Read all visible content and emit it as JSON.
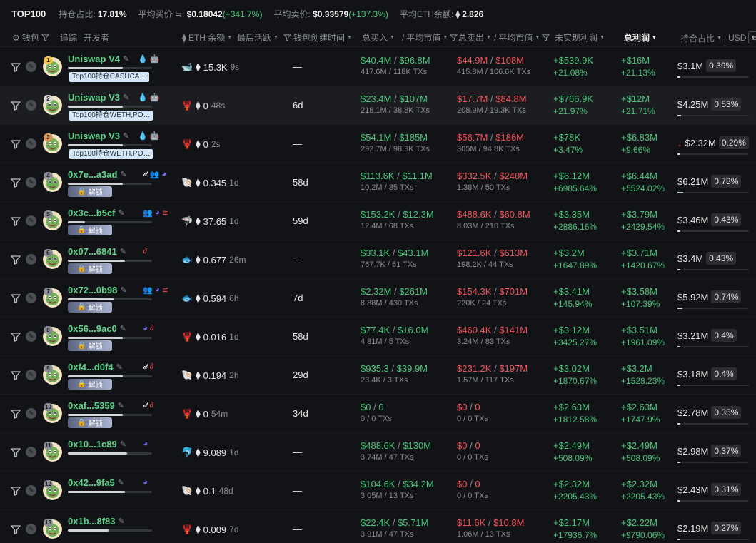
{
  "summary": {
    "title": "TOP100",
    "hold_label": "持仓占比:",
    "hold_value": "17.81%",
    "avg_buy_label": "平均买价 ≒:",
    "avg_buy_value": "$0.18042",
    "avg_buy_change": "(+341.7%)",
    "avg_sell_label": "平均卖价:",
    "avg_sell_value": "$0.33579",
    "avg_sell_change": "(+137.3%)",
    "eth_balance_label": "平均ETH余额:",
    "eth_balance_value": "2.826"
  },
  "header": {
    "wallet": "钱包",
    "track": "追踪",
    "developer": "开发者",
    "eth_balance": "ETH 余额",
    "last_active": "最后活跃",
    "wallet_created": "钱包创建时间",
    "total_buy": "总买入",
    "avg_mcap_buy": "平均市值",
    "total_sell": "总卖出",
    "avg_mcap_sell": "平均市值",
    "unrealized": "未实现利润",
    "total_profit": "总利润",
    "holding": "持合占比",
    "currency": "USD"
  },
  "colors": {
    "green": "#48c57a",
    "red": "#f0525b",
    "name": "#5fd38b"
  },
  "rows": [
    {
      "rank": "1",
      "name": "Uniswap V4",
      "tag": "Top100持仓CASHCA…",
      "locked": false,
      "icons": [
        "drops-icon",
        "robot-icon"
      ],
      "progress": 0.65,
      "animal": "whale-icon",
      "animal_glyph": "🐋",
      "eth": "15.3K",
      "ago": "9s",
      "created": "—",
      "buy": "$40.4M",
      "buy_mcap": "$96.8M",
      "buy_sub": "417.6M / 118K TXs",
      "sell": "$44.9M",
      "sell_mcap": "$108M",
      "sell_sub": "415.8M / 106.6K TXs",
      "unreal": "+$539.9K",
      "unreal_pct": "+21.08%",
      "total": "+$16M",
      "total_pct": "+21.13%",
      "hold": "$3.1M",
      "hold_pct": "0.39%",
      "hold_fill": 0.39,
      "down": false,
      "badge": "#f0c84a"
    },
    {
      "rank": "2",
      "name": "Uniswap V3",
      "tag": "Top100持仓WETH,PO…",
      "locked": false,
      "icons": [
        "drops-icon",
        "robot-icon"
      ],
      "progress": 0.65,
      "animal": "shrimp-icon",
      "animal_glyph": "🦞",
      "eth": "0",
      "ago": "48s",
      "created": "6d",
      "buy": "$23.4M",
      "buy_mcap": "$107M",
      "buy_sub": "218.1M / 38.8K TXs",
      "sell": "$17.7M",
      "sell_mcap": "$84.8M",
      "sell_sub": "208.9M / 19.3K TXs",
      "unreal": "+$766.9K",
      "unreal_pct": "+21.97%",
      "total": "+$12M",
      "total_pct": "+21.71%",
      "hold": "$4.25M",
      "hold_pct": "0.53%",
      "hold_fill": 0.53,
      "down": false,
      "badge": "#d8d8d8"
    },
    {
      "rank": "3",
      "name": "Uniswap V3",
      "tag": "Top100持仓WETH,PO…",
      "locked": false,
      "icons": [
        "drops-icon",
        "robot-icon"
      ],
      "progress": 0.65,
      "animal": "shrimp-icon",
      "animal_glyph": "🦞",
      "eth": "0",
      "ago": "2s",
      "created": "—",
      "buy": "$54.1M",
      "buy_mcap": "$185M",
      "buy_sub": "292.7M / 98.3K TXs",
      "sell": "$56.7M",
      "sell_mcap": "$186M",
      "sell_sub": "305M / 94.8K TXs",
      "unreal": "+$78K",
      "unreal_pct": "+3.47%",
      "total": "+$6.83M",
      "total_pct": "+9.66%",
      "hold": "$2.32M",
      "hold_pct": "0.29%",
      "hold_fill": 0.29,
      "down": true,
      "badge": "#d9985a"
    },
    {
      "rank": "4",
      "name": "0x7e...a3ad",
      "locked": true,
      "unlock_label": "解锁",
      "icons": [
        "tool-icon",
        "people-icon",
        "moon-icon"
      ],
      "progress": 0.65,
      "animal": "shell-icon",
      "animal_glyph": "🐚",
      "eth": "0.345",
      "ago": "1d",
      "created": "58d",
      "buy": "$113.6K",
      "buy_mcap": "$11.1M",
      "buy_sub": "10.2M / 35 TXs",
      "sell": "$332.5K",
      "sell_mcap": "$240M",
      "sell_sub": "1.38M / 50 TXs",
      "unreal": "+$6.12M",
      "unreal_pct": "+6985.64%",
      "total": "+$6.44M",
      "total_pct": "+5524.02%",
      "hold": "$6.21M",
      "hold_pct": "0.78%",
      "hold_fill": 0.78,
      "down": false,
      "badge": "#8a8d93"
    },
    {
      "rank": "5",
      "name": "0x3c...b5cf",
      "locked": true,
      "unlock_label": "解锁",
      "icons": [
        "people-icon",
        "moon-icon",
        "layers-icon"
      ],
      "progress": 0.2,
      "animal": "shark-icon",
      "animal_glyph": "🦈",
      "eth": "37.65",
      "ago": "1d",
      "created": "59d",
      "buy": "$153.2K",
      "buy_mcap": "$12.3M",
      "buy_sub": "12.4M / 68 TXs",
      "sell": "$488.6K",
      "sell_mcap": "$60.8M",
      "sell_sub": "8.03M / 210 TXs",
      "unreal": "+$3.35M",
      "unreal_pct": "+2886.16%",
      "total": "+$3.79M",
      "total_pct": "+2429.54%",
      "hold": "$3.46M",
      "hold_pct": "0.43%",
      "hold_fill": 0.43,
      "down": false,
      "badge": "#8a8d93"
    },
    {
      "rank": "6",
      "name": "0x07...6841",
      "locked": true,
      "unlock_label": "解锁",
      "icons": [
        "link-icon"
      ],
      "progress": 0.68,
      "animal": "fish-icon",
      "animal_glyph": "🐟",
      "eth": "0.677",
      "ago": "26m",
      "created": "—",
      "buy": "$33.1K",
      "buy_mcap": "$43.1M",
      "buy_sub": "767.7K / 51 TXs",
      "sell": "$121.6K",
      "sell_mcap": "$613M",
      "sell_sub": "198.2K / 44 TXs",
      "unreal": "+$3.2M",
      "unreal_pct": "+1647.89%",
      "total": "+$3.71M",
      "total_pct": "+1420.67%",
      "hold": "$3.4M",
      "hold_pct": "0.43%",
      "hold_fill": 0.43,
      "down": false,
      "badge": "#8a8d93"
    },
    {
      "rank": "7",
      "name": "0x72...0b98",
      "locked": true,
      "unlock_label": "解锁",
      "icons": [
        "people-icon",
        "moon-icon",
        "layers-icon"
      ],
      "progress": 0.55,
      "animal": "fish-icon",
      "animal_glyph": "🐟",
      "eth": "0.594",
      "ago": "6h",
      "created": "7d",
      "buy": "$2.32M",
      "buy_mcap": "$261M",
      "buy_sub": "8.88M / 430 TXs",
      "sell": "$154.3K",
      "sell_mcap": "$701M",
      "sell_sub": "220K / 24 TXs",
      "unreal": "+$3.41M",
      "unreal_pct": "+145.94%",
      "total": "+$3.58M",
      "total_pct": "+107.39%",
      "hold": "$5.92M",
      "hold_pct": "0.74%",
      "hold_fill": 0.74,
      "down": false,
      "badge": "#8a8d93"
    },
    {
      "rank": "8",
      "name": "0x56...9ac0",
      "locked": true,
      "unlock_label": "解锁",
      "icons": [
        "moon-icon",
        "link-icon"
      ],
      "progress": 0.65,
      "animal": "shrimp-icon",
      "animal_glyph": "🦞",
      "eth": "0.016",
      "ago": "1d",
      "created": "58d",
      "buy": "$77.4K",
      "buy_mcap": "$16.0M",
      "buy_sub": "4.81M / 5 TXs",
      "sell": "$460.4K",
      "sell_mcap": "$141M",
      "sell_sub": "3.24M / 83 TXs",
      "unreal": "+$3.12M",
      "unreal_pct": "+3425.27%",
      "total": "+$3.51M",
      "total_pct": "+1961.09%",
      "hold": "$3.21M",
      "hold_pct": "0.4%",
      "hold_fill": 0.4,
      "down": false,
      "badge": "#8a8d93"
    },
    {
      "rank": "9",
      "name": "0xf4...d0f4",
      "locked": true,
      "unlock_label": "解锁",
      "icons": [
        "tool-icon",
        "link-icon"
      ],
      "progress": 0.65,
      "animal": "shell-icon",
      "animal_glyph": "🐚",
      "eth": "0.194",
      "ago": "2h",
      "created": "29d",
      "buy": "$935.3",
      "buy_mcap": "$39.9M",
      "buy_sub": "23.4K / 3 TXs",
      "sell": "$231.2K",
      "sell_mcap": "$197M",
      "sell_sub": "1.57M / 117 TXs",
      "unreal": "+$3.02M",
      "unreal_pct": "+1870.67%",
      "total": "+$3.2M",
      "total_pct": "+1528.23%",
      "hold": "$3.18M",
      "hold_pct": "0.4%",
      "hold_fill": 0.4,
      "down": false,
      "badge": "#8a8d93"
    },
    {
      "rank": "10",
      "name": "0xaf...5359",
      "locked": true,
      "unlock_label": "解锁",
      "icons": [
        "tool-icon",
        "link-icon"
      ],
      "progress": 0.65,
      "animal": "shrimp-icon",
      "animal_glyph": "🦞",
      "eth": "0",
      "ago": "54m",
      "created": "34d",
      "buy": "$0",
      "buy_mcap": "0",
      "buy_sub": "0 / 0 TXs",
      "sell": "$0",
      "sell_mcap": "0",
      "sell_sub": "0 / 0 TXs",
      "unreal": "+$2.63M",
      "unreal_pct": "+1812.58%",
      "total": "+$2.63M",
      "total_pct": "+1747.9%",
      "hold": "$2.78M",
      "hold_pct": "0.35%",
      "hold_fill": 0.35,
      "down": false,
      "badge": "#8a8d93"
    },
    {
      "rank": "11",
      "name": "0x10...1c89",
      "locked": false,
      "icons": [
        "moon-icon"
      ],
      "progress": 0.7,
      "animal": "dolphin-icon",
      "animal_glyph": "🐬",
      "eth": "9.089",
      "ago": "1d",
      "created": "—",
      "buy": "$488.6K",
      "buy_mcap": "$130M",
      "buy_sub": "3.74M / 47 TXs",
      "sell": "$0",
      "sell_mcap": "0",
      "sell_sub": "0 / 0 TXs",
      "unreal": "+$2.49M",
      "unreal_pct": "+508.09%",
      "total": "+$2.49M",
      "total_pct": "+508.09%",
      "hold": "$2.98M",
      "hold_pct": "0.37%",
      "hold_fill": 0.37,
      "down": false,
      "badge": "#8a8d93"
    },
    {
      "rank": "12",
      "name": "0x42...9fa5",
      "locked": false,
      "icons": [
        "moon-icon"
      ],
      "progress": 0.68,
      "animal": "shell-icon",
      "animal_glyph": "🐚",
      "eth": "0.1",
      "ago": "48d",
      "created": "—",
      "buy": "$104.6K",
      "buy_mcap": "$34.2M",
      "buy_sub": "3.05M / 13 TXs",
      "sell": "$0",
      "sell_mcap": "0",
      "sell_sub": "0 / 0 TXs",
      "unreal": "+$2.32M",
      "unreal_pct": "+2205.43%",
      "total": "+$2.32M",
      "total_pct": "+2205.43%",
      "hold": "$2.43M",
      "hold_pct": "0.31%",
      "hold_fill": 0.31,
      "down": false,
      "badge": "#8a8d93"
    },
    {
      "rank": "13",
      "name": "0x1b...8f83",
      "locked": false,
      "icons": [],
      "progress": 0.48,
      "animal": "shrimp-icon",
      "animal_glyph": "🦞",
      "eth": "0.009",
      "ago": "7d",
      "created": "—",
      "buy": "$22.4K",
      "buy_mcap": "$5.71M",
      "buy_sub": "3.91M / 47 TXs",
      "sell": "$11.6K",
      "sell_mcap": "$10.8M",
      "sell_sub": "1.06M / 13 TXs",
      "unreal": "+$2.17M",
      "unreal_pct": "+17936.7%",
      "total": "+$2.22M",
      "total_pct": "+9790.06%",
      "hold": "$2.19M",
      "hold_pct": "0.27%",
      "hold_fill": 0.27,
      "down": false,
      "badge": "#8a8d93"
    }
  ]
}
